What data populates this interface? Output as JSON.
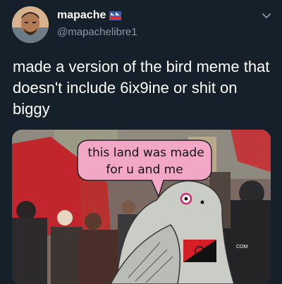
{
  "tweet": {
    "display_name": "mapache",
    "handle": "@mapachelibre1",
    "text": "made a version of the bird meme that doesn't include 6ix9ine or shit on biggy",
    "icons": {
      "avatar": "user-avatar",
      "flag": "flag-emoji-icon",
      "menu": "chevron-down-icon"
    }
  },
  "media": {
    "speech_bubble_lines": [
      "this land was made",
      "for u and me"
    ],
    "watermark": "COM"
  },
  "colors": {
    "background": "#15202b",
    "secondary_text": "#8899a6",
    "bubble_fill": "#f3a7c7",
    "pigeon": "#c9cdc6"
  }
}
